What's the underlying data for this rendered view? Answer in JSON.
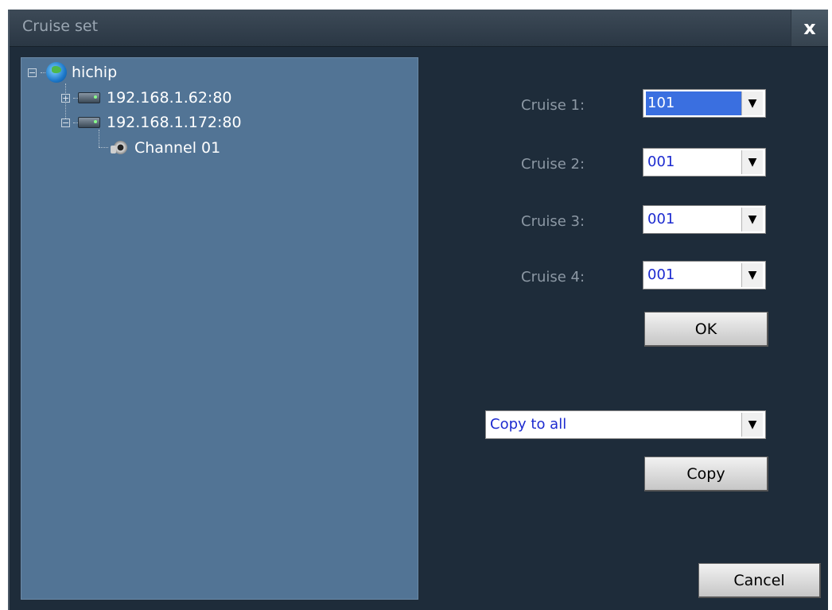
{
  "dialog": {
    "title": "Cruise set",
    "close_label": "x"
  },
  "tree": {
    "root": "hichip",
    "devices": [
      {
        "label": "192.168.1.62:80",
        "expander": "+"
      },
      {
        "label": "192.168.1.172:80",
        "expander": "−"
      }
    ],
    "root_expander": "−",
    "channel": "Channel 01"
  },
  "cruises": [
    {
      "label": "Cruise 1:",
      "value": "101"
    },
    {
      "label": "Cruise 2:",
      "value": "001"
    },
    {
      "label": "Cruise 3:",
      "value": "001"
    },
    {
      "label": "Cruise 4:",
      "value": "001"
    }
  ],
  "buttons": {
    "ok": "OK",
    "copy": "Copy",
    "cancel": "Cancel"
  },
  "copy_select": {
    "value": "Copy to all"
  },
  "arrow_glyph": "▼"
}
